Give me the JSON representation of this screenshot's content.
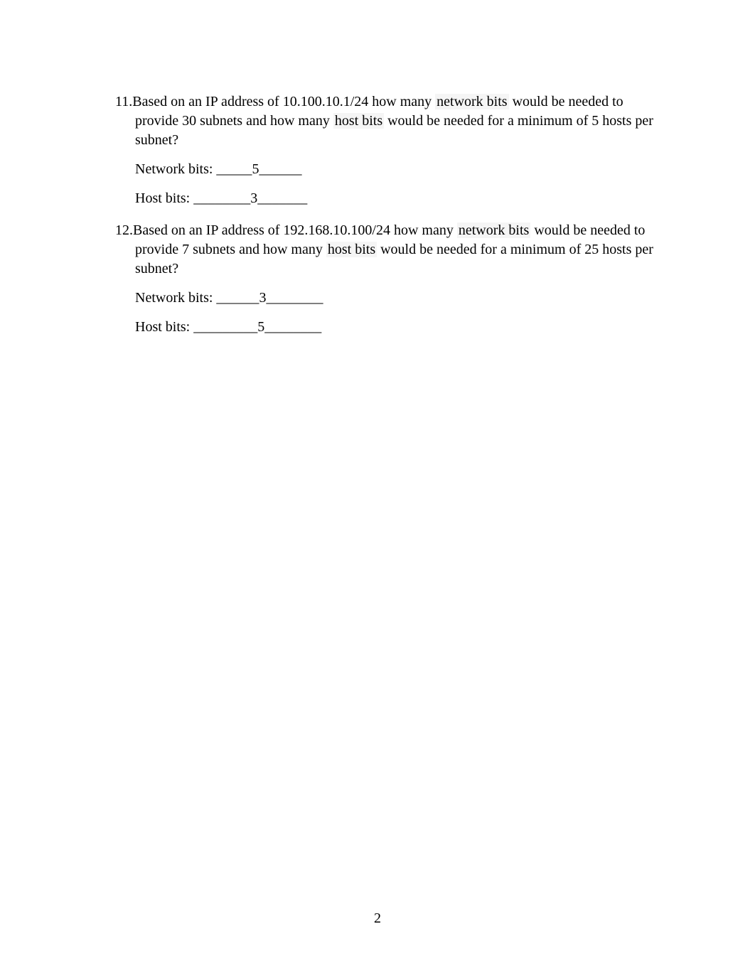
{
  "questions": [
    {
      "number": "11.",
      "parts": {
        "p1": "Based on an IP address of 10.100.10.1/24 how many ",
        "h1": "network bits",
        "p2": " would be needed to provide 30 subnets and how many ",
        "h2": "host bits",
        "p3": " would be needed for a minimum of 5 hosts per subnet?"
      },
      "answers": {
        "network_label": "Network bits: _____",
        "network_value": "5",
        "network_suffix": "______",
        "host_label": "Host bits: ________",
        "host_value": "3",
        "host_suffix": "_______"
      }
    },
    {
      "number": "12.",
      "parts": {
        "p1": "Based on an IP address of 192.168.10.100/24 how many ",
        "h1": "network bits",
        "p2": " would be needed to provide 7 subnets and how many ",
        "h2": "host bits",
        "p3": " would be needed for a minimum of 25 hosts per subnet?"
      },
      "answers": {
        "network_label": "Network bits: ______",
        "network_value": "3",
        "network_suffix": "________",
        "host_label": "Host bits: _________",
        "host_value": "5",
        "host_suffix": "________"
      }
    }
  ],
  "page_number": "2"
}
